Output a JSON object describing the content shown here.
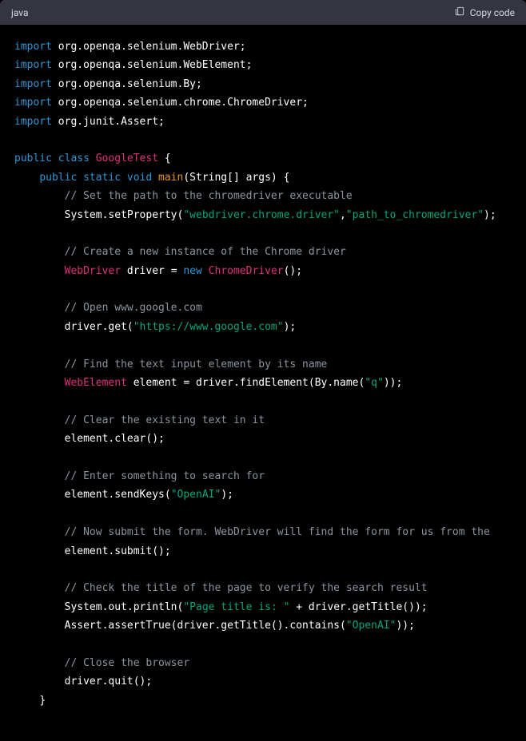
{
  "header": {
    "language": "java",
    "copy_label": "Copy code"
  },
  "code": {
    "imports": [
      [
        "import",
        " ",
        "org.openqa.selenium.WebDriver;"
      ],
      [
        "import",
        " ",
        "org.openqa.selenium.WebElement;"
      ],
      [
        "import",
        " ",
        "org.openqa.selenium.By;"
      ],
      [
        "import",
        " ",
        "org.openqa.selenium.chrome.ChromeDriver;"
      ],
      [
        "import",
        " ",
        "org.junit.Assert;"
      ]
    ],
    "class_kw": "public",
    "class_kw2": "class",
    "class_name": "GoogleTest",
    "method_mods": "public static void",
    "method_name": "main",
    "method_args": "(String[] args)",
    "comments": {
      "c1": "// Set the path to the chromedriver executable",
      "c2": "// Create a new instance of the Chrome driver",
      "c3": "// Open www.google.com",
      "c4": "// Find the text input element by its name",
      "c5": "// Clear the existing text in it",
      "c6": "// Enter something to search for",
      "c7": "// Now submit the form. WebDriver will find the form for us from the",
      "c8": "// Check the title of the page to verify the search result",
      "c9": "// Close the browser"
    },
    "strings": {
      "s1": "\"webdriver.chrome.driver\"",
      "s2": "\"path_to_chromedriver\"",
      "s3": "\"https://www.google.com\"",
      "s4": "\"q\"",
      "s5": "\"OpenAI\"",
      "s6": "\"Page title is: \"",
      "s7": "\"OpenAI\""
    },
    "plain": {
      "p_sys": "System.setProperty(",
      "p_syscomma": ",",
      "p_sysend": ");",
      "p_driver_decl_a": " driver = ",
      "p_new": "new",
      "p_cd": "ChromeDriver",
      "p_cd_tail": "();",
      "p_driver_get_a": "driver.get(",
      "p_close_paren_semi": ");",
      "p_we_decl": " element = driver.findElement(By.name(",
      "p_we_tail": "));",
      "p_el_clear": "element.clear();",
      "p_el_send_a": "element.sendKeys(",
      "p_el_submit": "element.submit();",
      "p_println_a": "System.out.println(",
      "p_println_mid": " + driver.getTitle());",
      "p_assert_a": "Assert.assertTrue(driver.getTitle().contains(",
      "p_assert_tail": "));",
      "p_quit": "driver.quit();"
    },
    "types": {
      "WebDriver": "WebDriver",
      "WebElement": "WebElement"
    },
    "braces": {
      "open": "{",
      "close": "}"
    }
  }
}
